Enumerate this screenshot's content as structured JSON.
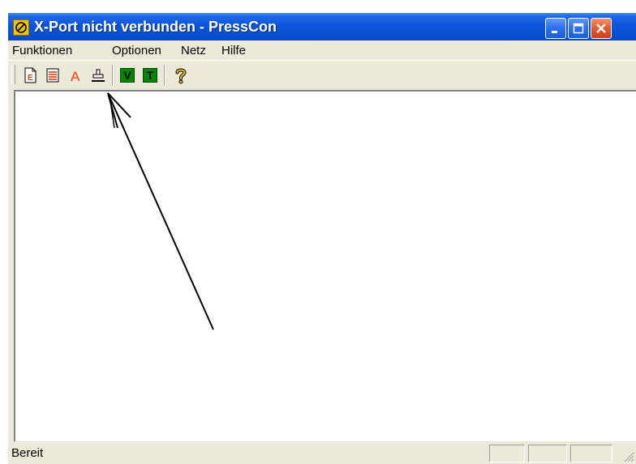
{
  "window": {
    "title": "X-Port nicht verbunden - PressCon"
  },
  "menu": {
    "items": [
      "Funktionen",
      "Optionen",
      "Netz",
      "Hilfe"
    ]
  },
  "toolbar": {
    "buttons": [
      {
        "icon": "document-e-icon",
        "glyph": "E",
        "color": "#cc4400"
      },
      {
        "icon": "document-lines-icon",
        "color": "#cc3300"
      },
      {
        "icon": "letter-a-icon",
        "glyph": "A",
        "color": "#ff4400"
      },
      {
        "icon": "stamp-press-icon",
        "color": "#000000"
      },
      {
        "icon": "v-box-icon",
        "glyph": "V",
        "color": "#008800"
      },
      {
        "icon": "t-box-icon",
        "glyph": "T",
        "color": "#008800"
      },
      {
        "icon": "help-question-icon",
        "glyph": "?",
        "color": "#f5c400"
      }
    ]
  },
  "status": {
    "text": "Bereit"
  },
  "colors": {
    "titlebar": "#0a54dc",
    "face": "#ece9d8",
    "close": "#e45a2e"
  }
}
